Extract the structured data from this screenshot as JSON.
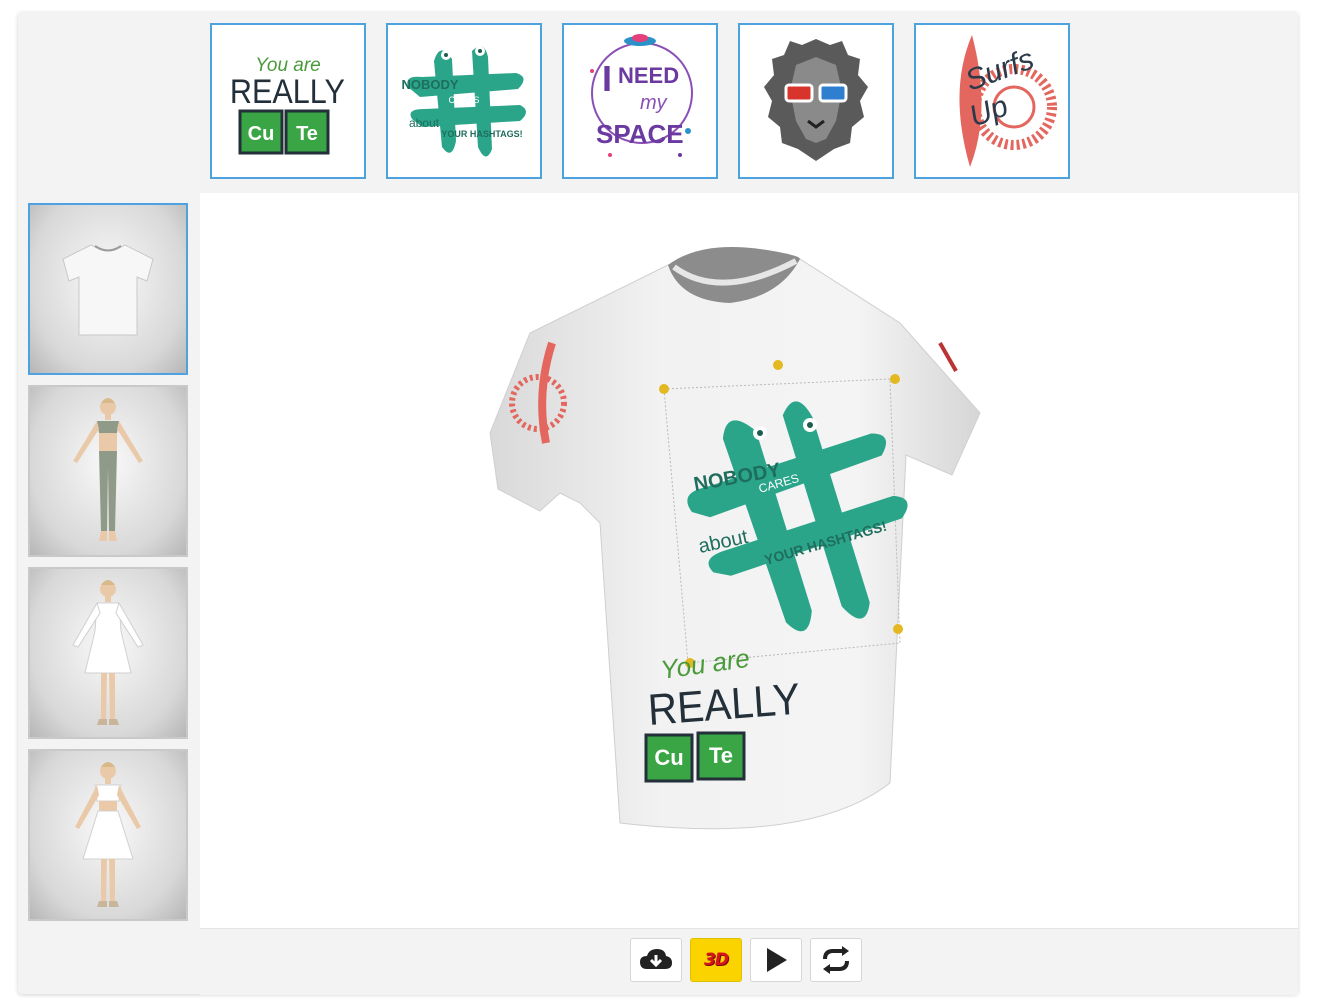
{
  "colors": {
    "accent_border": "#4ea2e0",
    "active_button": "#fbd400",
    "design_green": "#2aa58a",
    "periodic_green": "#3aa544"
  },
  "designs": [
    {
      "id": "really-cute",
      "line1": "You are",
      "line2": "REALLY",
      "symbols": [
        "Cu",
        "Te"
      ]
    },
    {
      "id": "hashtags",
      "words": [
        "NOBODY",
        "CARES",
        "about",
        "YOUR HASHTAGS!"
      ]
    },
    {
      "id": "need-space",
      "words": [
        "I",
        "NEED",
        "my",
        "SPACE"
      ]
    },
    {
      "id": "lion-glasses",
      "icon": "lion-3d-glasses-icon"
    },
    {
      "id": "surfs-up",
      "words": [
        "Surfs",
        "Up"
      ]
    }
  ],
  "models": [
    {
      "id": "tshirt",
      "icon": "tshirt-icon",
      "selected": true
    },
    {
      "id": "avatar-sport",
      "icon": "avatar-sport-icon",
      "selected": false
    },
    {
      "id": "avatar-dress",
      "icon": "avatar-dress-icon",
      "selected": false
    },
    {
      "id": "avatar-skirt",
      "icon": "avatar-skirt-icon",
      "selected": false
    }
  ],
  "preview": {
    "front_design": {
      "words": [
        "NOBODY",
        "CARES",
        "about",
        "YOUR HASHTAGS!"
      ]
    },
    "bottom_design": {
      "line1": "You are",
      "line2": "REALLY",
      "symbols": [
        "Cu",
        "Te"
      ]
    }
  },
  "toolbar": {
    "download_icon": "cloud-download-icon",
    "view_3d_label": "3D",
    "play_icon": "play-icon",
    "rotate_icon": "rotate-icon"
  }
}
